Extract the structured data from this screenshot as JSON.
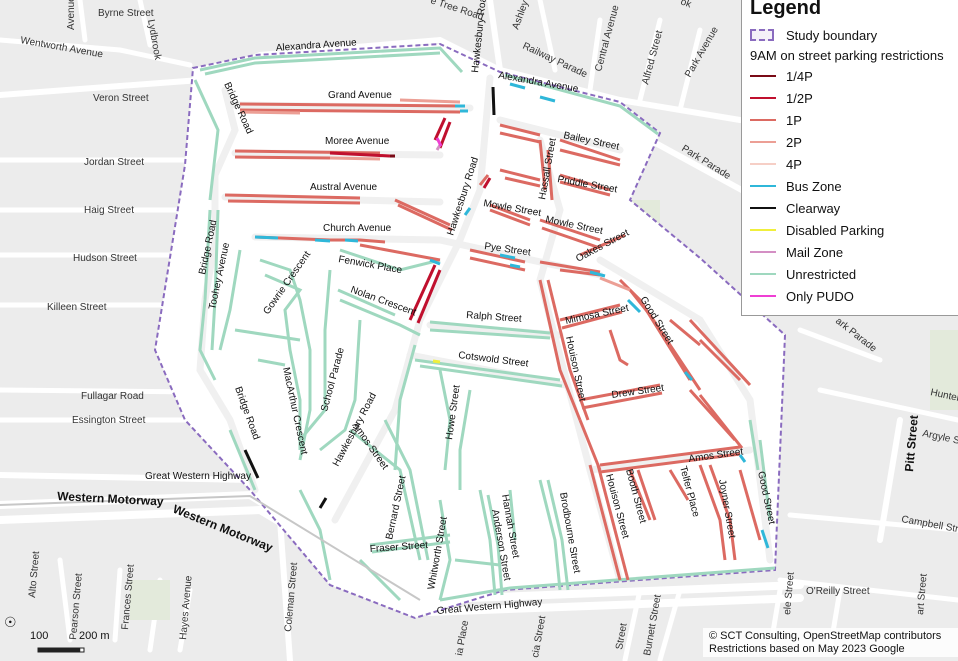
{
  "legend": {
    "title": "Legend",
    "boundary_label": "Study boundary",
    "subtitle": "9AM on street parking restrictions",
    "items": [
      {
        "label": "1/4P",
        "color": "#7a0a16"
      },
      {
        "label": "1/2P",
        "color": "#c0102e"
      },
      {
        "label": "1P",
        "color": "#dc6a62"
      },
      {
        "label": "2P",
        "color": "#ec9f95"
      },
      {
        "label": "4P",
        "color": "#f6cfc6"
      },
      {
        "label": "Bus Zone",
        "color": "#2fb7d9"
      },
      {
        "label": "Clearway",
        "color": "#111111"
      },
      {
        "label": "Disabled Parking",
        "color": "#f0ef3c"
      },
      {
        "label": "Mail Zone",
        "color": "#d48fc4"
      },
      {
        "label": "Unrestricted",
        "color": "#9fd8bf"
      },
      {
        "label": "Only PUDO",
        "color": "#ef3fd4"
      }
    ]
  },
  "streets": {
    "alexandra_avenue": "Alexandra Avenue",
    "grand_avenue": "Grand Avenue",
    "moree_avenue": "Moree Avenue",
    "austral_avenue": "Austral Avenue",
    "church_avenue": "Church Avenue",
    "bridge_road": "Bridge Road",
    "hawkesbury_road": "Hawkesbury Road",
    "bailey_street": "Bailey Street",
    "hassall_street": "Hassall Street",
    "priddle_street": "Priddle Street",
    "mowle_street": "Mowle Street",
    "pye_street": "Pye Street",
    "oakes_street": "Oakes Street",
    "fenwick_place": "Fenwick Place",
    "nolan_crescent": "Nolan Crescent",
    "gowrie_crescent": "Gowrie Crescent",
    "toohey_avenue": "Toohey Avenue",
    "ralph_street": "Ralph Street",
    "mimosa_street": "Mimosa Street",
    "good_street": "Good Street",
    "cotswold_street": "Cotswold Street",
    "houison_street": "Houison Street",
    "school_parade": "School Parade",
    "macarthur_crescent": "MacArthur Crescent",
    "drew_street": "Drew Street",
    "amos_street": "Amos Street",
    "howe_street": "Howe Street",
    "booth_street": "Booth Street",
    "telfer_place": "Telfer Place",
    "joyner_street": "Joyner Street",
    "bernard_street": "Bernard Street",
    "fraser_street": "Fraser Street",
    "whitworth_street": "Whitworth Street",
    "hannah_street": "Hannah Street",
    "anderson_street": "Anderson Street",
    "brodbourne_street": "Brodbourne Street",
    "great_western_highway": "Great Western Highway",
    "western_motorway": "Western Motorway"
  },
  "outside": {
    "byrne_street": "Byrne Street",
    "lydbrook": "Lydbrook",
    "avenue_top": "Avenue",
    "wentworth_avenue": "Wentworth Avenue",
    "veron_street": "Veron Street",
    "jordan_street": "Jordan Street",
    "haig_street": "Haig Street",
    "hudson_street": "Hudson Street",
    "killeen_street": "Killeen Street",
    "fullagar_road": "Fullagar Road",
    "essington_street": "Essington Street",
    "tree_road": "e Tree Road",
    "ashley_lane": "Ashley La",
    "railway_parade": "Railway Parade",
    "central_avenue": "Central Avenue",
    "alfred_street": "Alfred Street",
    "park_avenue": "Park Avenue",
    "park_parade": "Park Parade",
    "park_parade_2": "ark Parade",
    "hunter": "Hunter",
    "argyle": "Argyle S",
    "pitt_street": "Pitt Street",
    "campbell_street": "Campbell Stre",
    "oreilly_street": "O'Reilly Street",
    "alto_street": "Alto Street",
    "pearson_street": "Pearson Street",
    "frances_street": "Frances Street",
    "hayes_avenue": "Hayes Avenue",
    "coleman_street": "Coleman Street",
    "burnett_street": "Burnett Street",
    "street_bottom": "Street",
    "ia_place": "ia Place",
    "ccia_street": "cia Street",
    "ele_street": "ele Street",
    "art_street": "art Street",
    "top_right": "ok"
  },
  "scale": {
    "value": "100",
    "unit": "200 m"
  },
  "attribution": {
    "line1": "© SCT Consulting, OpenStreetMap contributors",
    "line2": "Restrictions based on May 2023 Google"
  },
  "icons": {
    "north": "north-arrow-icon"
  }
}
